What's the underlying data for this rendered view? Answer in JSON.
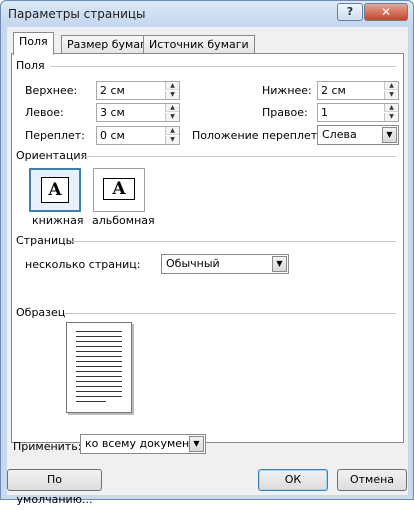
{
  "window": {
    "title": "Параметры страницы",
    "help_label": "?",
    "close_label": "✕"
  },
  "tabs": [
    "Поля",
    "Размер бумаги",
    "Источник бумаги"
  ],
  "margins": {
    "section_label": "Поля",
    "top_label": "Верхнее:",
    "top_value": "2 см",
    "left_label": "Левое:",
    "left_value": "3 см",
    "gutter_label": "Переплет:",
    "gutter_value": "0 см",
    "bottom_label": "Нижнее:",
    "bottom_value": "2 см",
    "right_label": "Правое:",
    "right_value": "1",
    "gutter_pos_label": "Положение переплета:",
    "gutter_pos_value": "Слева"
  },
  "orientation": {
    "section_label": "Ориентация",
    "portrait_label": "книжная",
    "landscape_label": "альбомная",
    "icon_letter": "A"
  },
  "pages": {
    "section_label": "Страницы",
    "multiple_label": "несколько страниц:",
    "multiple_value": "Обычный"
  },
  "sample": {
    "section_label": "Образец"
  },
  "apply": {
    "label": "Применить:",
    "value": "ко всему документу"
  },
  "buttons": {
    "default": "По умолчанию...",
    "ok": "ОК",
    "cancel": "Отмена"
  },
  "icons": {
    "spin_up": "▲",
    "spin_down": "▼",
    "dropdown": "▼"
  }
}
